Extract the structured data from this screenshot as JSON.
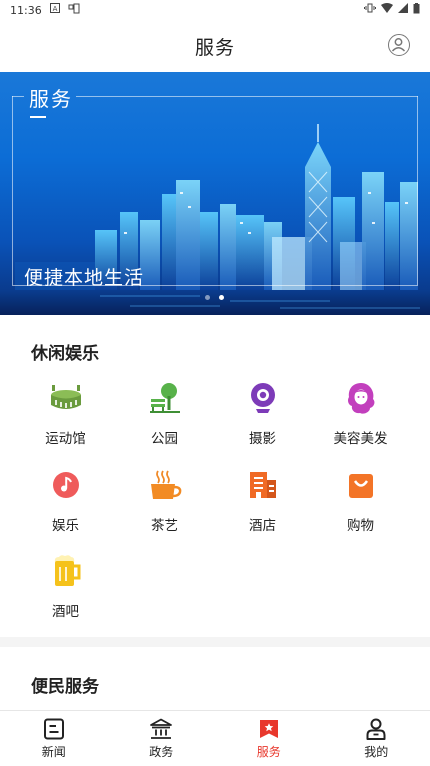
{
  "status_bar": {
    "time": "11:36"
  },
  "header": {
    "title": "服务"
  },
  "banner": {
    "tag": "服务",
    "caption": "便捷本地生活",
    "active_slide": 2,
    "slide_count": 2
  },
  "leisure": {
    "title": "休闲娱乐",
    "items": [
      {
        "label": "运动馆",
        "icon": "stadium-icon"
      },
      {
        "label": "公园",
        "icon": "park-icon"
      },
      {
        "label": "摄影",
        "icon": "webcam-icon"
      },
      {
        "label": "美容美发",
        "icon": "salon-icon"
      },
      {
        "label": "娱乐",
        "icon": "music-icon"
      },
      {
        "label": "茶艺",
        "icon": "tea-cup-icon"
      },
      {
        "label": "酒店",
        "icon": "hotel-icon"
      },
      {
        "label": "购物",
        "icon": "shopping-bag-icon"
      },
      {
        "label": "酒吧",
        "icon": "beer-icon"
      }
    ]
  },
  "convenience": {
    "title": "便民服务"
  },
  "nav": {
    "items": [
      {
        "label": "新闻",
        "icon": "news-icon"
      },
      {
        "label": "政务",
        "icon": "government-icon"
      },
      {
        "label": "服务",
        "icon": "service-icon",
        "active": true
      },
      {
        "label": "我的",
        "icon": "user-icon"
      }
    ]
  },
  "colors": {
    "accent": "#e8372c",
    "banner_blue": "#0c6dd6"
  }
}
